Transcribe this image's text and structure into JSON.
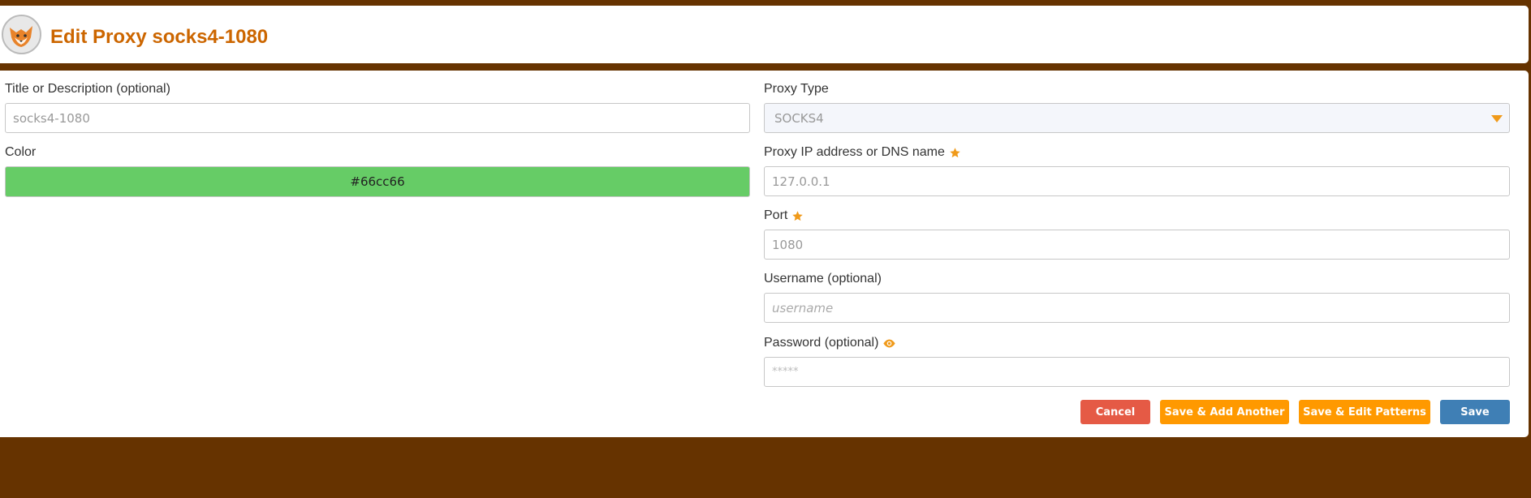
{
  "header": {
    "title": "Edit Proxy socks4-1080"
  },
  "form": {
    "title_label": "Title or Description (optional)",
    "title_value": "socks4-1080",
    "color_label": "Color",
    "color_value": "#66cc66",
    "proxy_type_label": "Proxy Type",
    "proxy_type_value": "SOCKS4",
    "address_label": "Proxy IP address or DNS name",
    "address_placeholder": "127.0.0.1",
    "port_label": "Port",
    "port_placeholder": "1080",
    "username_label": "Username (optional)",
    "username_placeholder": "username",
    "password_label": "Password (optional)",
    "password_placeholder": "*****"
  },
  "buttons": {
    "cancel": "Cancel",
    "save_add_another": "Save & Add Another",
    "save_edit_patterns": "Save & Edit Patterns",
    "save": "Save"
  },
  "icons": {
    "logo": "foxyproxy-logo",
    "required": "star-icon",
    "show_password": "eye-icon",
    "dropdown": "caret-down-icon"
  },
  "colors": {
    "background": "#663300",
    "title": "#cc6600",
    "accent": "#ff9900",
    "cancel": "#e55a45",
    "save": "#3f7fb5",
    "proxy_color": "#66cc66"
  }
}
